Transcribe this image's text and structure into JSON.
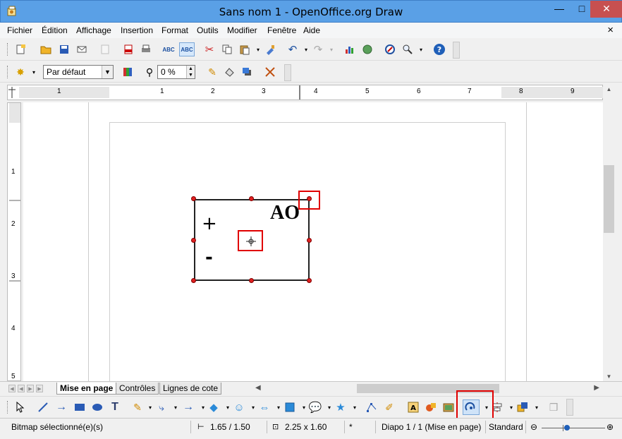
{
  "window": {
    "title": "Sans nom 1 - OpenOffice.org Draw",
    "minimize": "—",
    "maximize": "□",
    "close": "✕"
  },
  "menu": {
    "items": [
      "Fichier",
      "Édition",
      "Affichage",
      "Insertion",
      "Format",
      "Outils",
      "Modifier",
      "Fenêtre",
      "Aide"
    ],
    "close_doc": "×"
  },
  "toolbar_line": {
    "style": "Par défaut",
    "transparency": "0 %"
  },
  "ruler": {
    "h_numbers": [
      "1",
      "1",
      "2",
      "3",
      "4",
      "5",
      "6",
      "7",
      "8",
      "9"
    ],
    "v_numbers": [
      "1",
      "2",
      "3",
      "4",
      "5"
    ]
  },
  "canvas": {
    "plus": "+",
    "minus": "-",
    "label": "AO",
    "colors": {
      "handle": "#e02020",
      "highlight": "#e00000"
    }
  },
  "tabs": [
    "Mise en page",
    "Contrôles",
    "Lignes de cote"
  ],
  "status": {
    "selection": "Bitmap sélectionné(e)(s)",
    "position": "1.65 / 1.50",
    "size": "2.25 x 1.60",
    "modified": "*",
    "slide": "Diapo 1 / 1 (Mise en page)",
    "style": "Standard"
  }
}
